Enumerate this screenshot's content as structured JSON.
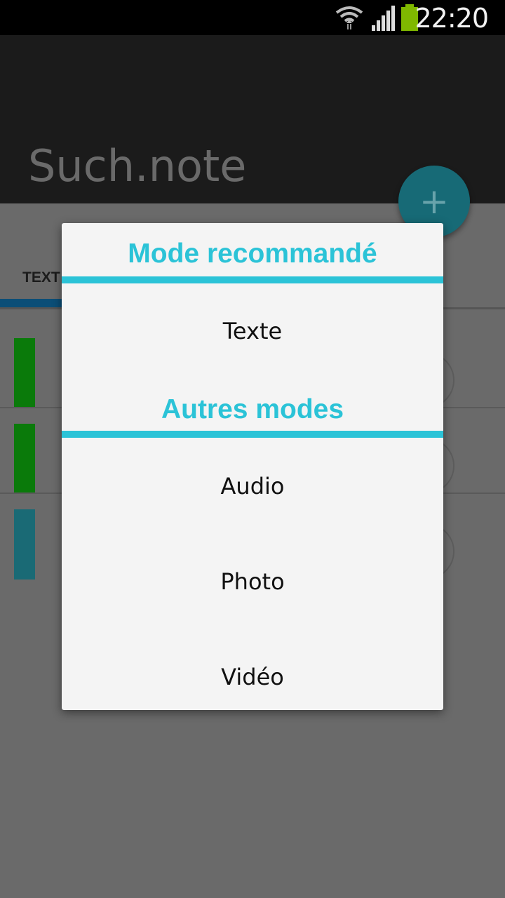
{
  "status_bar": {
    "time": "22:20",
    "icons": [
      "wifi-icon",
      "signal-icon",
      "battery-icon"
    ],
    "battery_color": "#7fb800"
  },
  "app": {
    "title": "Such.note",
    "tab_label": "TEXT",
    "fab_icon": "plus-icon",
    "fab_symbol": "+",
    "note_colors": [
      "#0a7a0a",
      "#0a7a0a",
      "#1a6a75"
    ]
  },
  "dialog": {
    "accent_color": "#2bc3d7",
    "recommended_header": "Mode recommandé",
    "recommended_options": [
      "Texte"
    ],
    "other_header": "Autres modes",
    "other_options": [
      "Audio",
      "Photo",
      "Vidéo"
    ]
  }
}
